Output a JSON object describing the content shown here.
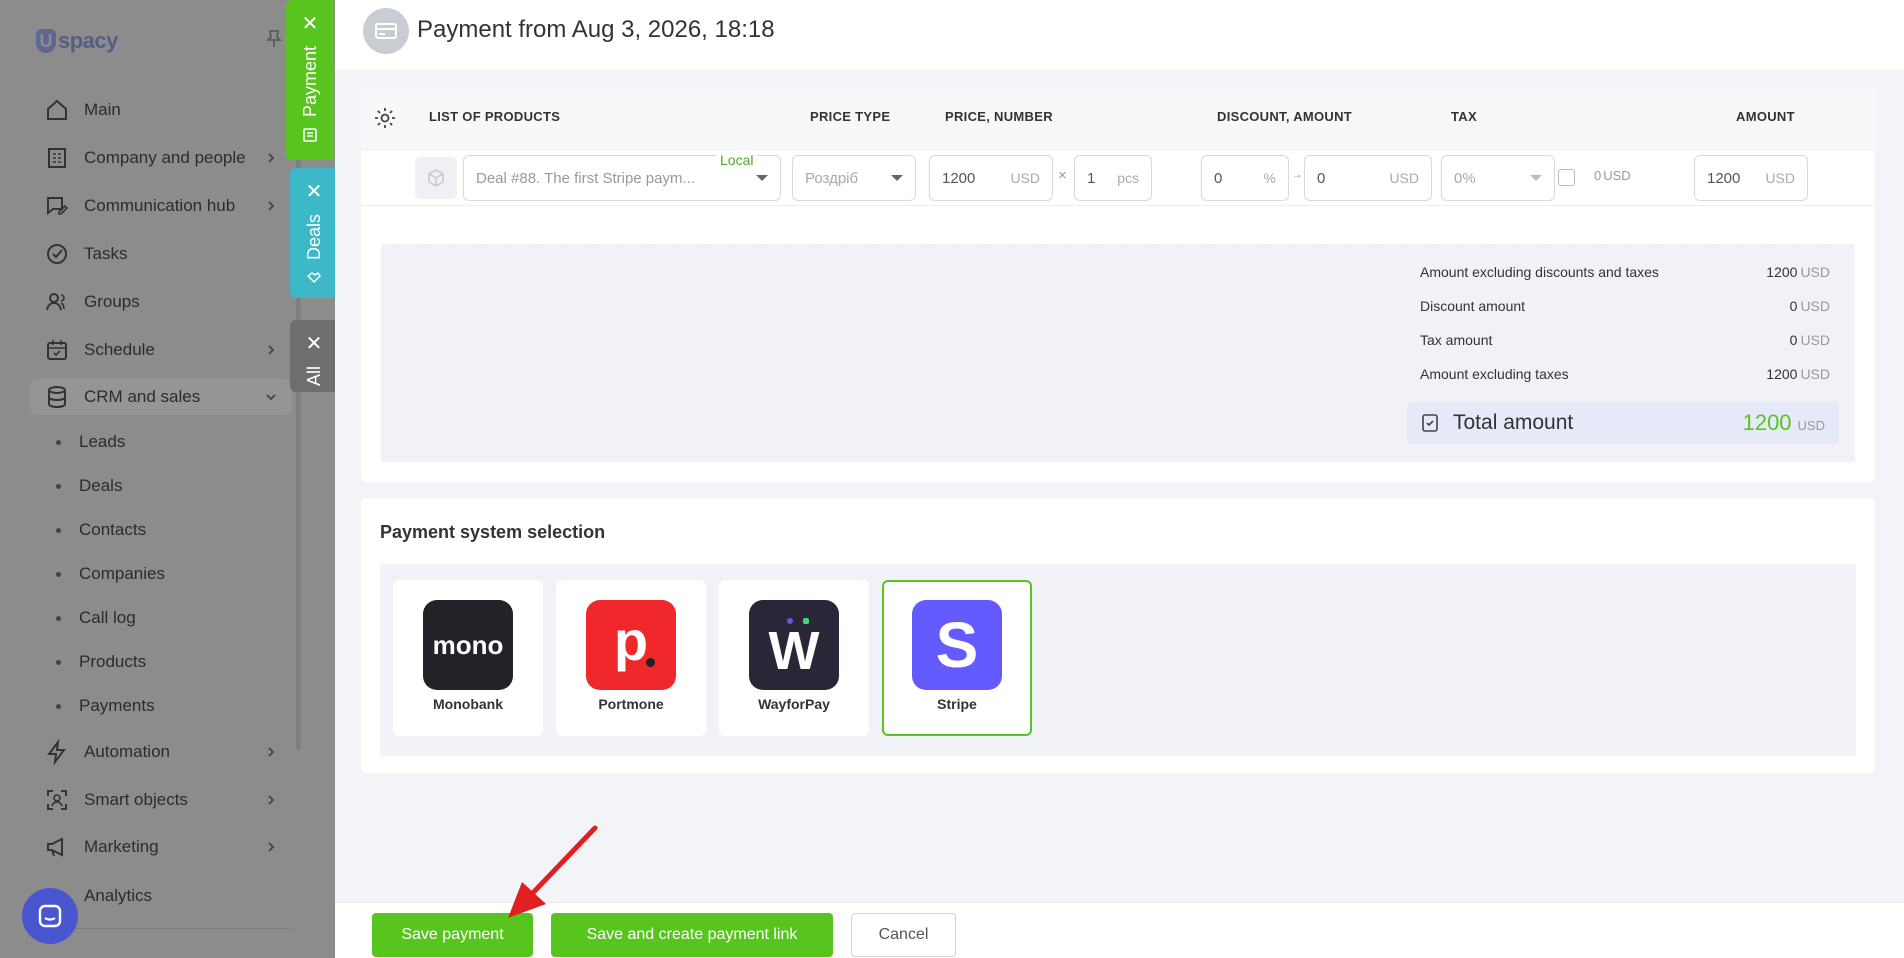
{
  "sidebar": {
    "logo_text": "spacy",
    "items": [
      {
        "label": "Main",
        "icon": "home-icon"
      },
      {
        "label": "Company and people",
        "icon": "building-icon"
      },
      {
        "label": "Communication hub",
        "icon": "chat-edit-icon"
      },
      {
        "label": "Tasks",
        "icon": "check-circle-icon"
      },
      {
        "label": "Groups",
        "icon": "users-icon"
      },
      {
        "label": "Schedule",
        "icon": "calendar-icon"
      },
      {
        "label": "CRM and sales",
        "icon": "database-icon"
      },
      {
        "label": "Automation",
        "icon": "bolt-icon"
      },
      {
        "label": "Smart objects",
        "icon": "scan-icon"
      },
      {
        "label": "Marketing",
        "icon": "megaphone-icon"
      },
      {
        "label": "Analytics",
        "icon": "chart-icon"
      }
    ],
    "crm_subitems": [
      "Leads",
      "Deals",
      "Contacts",
      "Companies",
      "Call log",
      "Products",
      "Payments"
    ]
  },
  "tabs": {
    "payment": "Payment",
    "deals": "Deals",
    "all": "All"
  },
  "header": {
    "title": "Payment from Aug 3, 2026, 18:18"
  },
  "products": {
    "columns": {
      "list": "LIST OF PRODUCTS",
      "price_type": "PRICE TYPE",
      "price_number": "PRICE, NUMBER",
      "discount": "DISCOUNT, AMOUNT",
      "tax": "TAX",
      "amount": "AMOUNT"
    },
    "row": {
      "product": "Deal #88. The first Stripe paym...",
      "local_badge": "Local",
      "price_type": "Роздріб",
      "price": "1200",
      "price_currency": "USD",
      "multiply": "×",
      "quantity": "1",
      "quantity_unit": "pcs",
      "discount_percent": "0",
      "percent_sign": "%",
      "arrow": "→",
      "discount_amount": "0",
      "discount_currency": "USD",
      "tax": "0%",
      "tax_amount": "0",
      "tax_currency": "USD",
      "amount": "1200",
      "amount_currency": "USD"
    }
  },
  "summary": {
    "rows": [
      {
        "label": "Amount excluding discounts and taxes",
        "value": "1200",
        "currency": "USD"
      },
      {
        "label": "Discount amount",
        "value": "0",
        "currency": "USD"
      },
      {
        "label": "Tax amount",
        "value": "0",
        "currency": "USD"
      },
      {
        "label": "Amount excluding taxes",
        "value": "1200",
        "currency": "USD"
      }
    ],
    "total_label": "Total amount",
    "total_value": "1200",
    "total_currency": "USD"
  },
  "payment_systems": {
    "title": "Payment system selection",
    "items": [
      {
        "name": "Monobank",
        "logo_text": "mono",
        "color": "#222328"
      },
      {
        "name": "Portmone",
        "logo_text": "p",
        "color": "#f0272b"
      },
      {
        "name": "WayforPay",
        "logo_text": "W",
        "color": "#2a2638"
      },
      {
        "name": "Stripe",
        "logo_text": "S",
        "color": "#635bff"
      }
    ],
    "selected": "Stripe"
  },
  "footer": {
    "save": "Save payment",
    "save_link": "Save and create payment link",
    "cancel": "Cancel"
  },
  "colors": {
    "accent_green": "#58c51f",
    "deals_tab": "#3db8c8",
    "stripe": "#635bff"
  }
}
